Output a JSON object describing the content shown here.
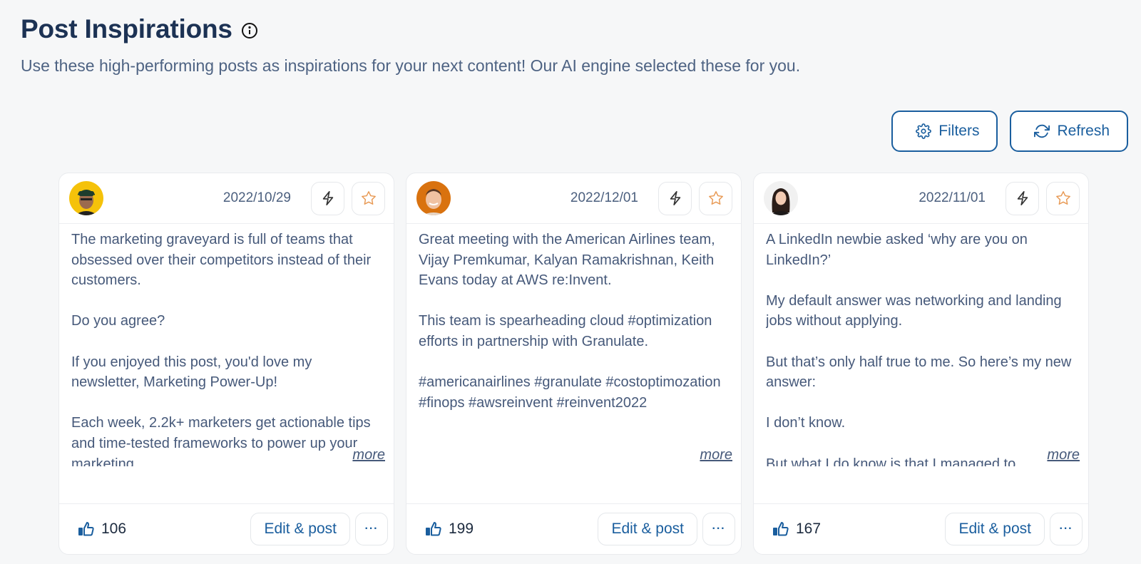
{
  "header": {
    "title": "Post Inspirations",
    "info_icon": "info-circle-icon",
    "subtitle": "Use these high-performing posts as inspirations for your next content! Our AI engine selected these for you."
  },
  "toolbar": {
    "filters_label": "Filters",
    "filters_icon": "gear-icon",
    "refresh_label": "Refresh",
    "refresh_icon": "refresh-icon"
  },
  "colors": {
    "accent": "#1a5e9e",
    "title": "#1c3254",
    "body_text": "#46597a",
    "star": "#e89a55",
    "background": "#f6f7f8"
  },
  "cards": [
    {
      "date": "2022/10/29",
      "avatar": "avatar-man-cap-yellow-bg",
      "text": "The marketing graveyard is full of teams that obsessed over their competitors instead of their customers.\n\nDo you agree?\n\nIf you enjoyed this post, you'd love my newsletter, Marketing Power-Up!\n\nEach week, 2.2k+ marketers get actionable tips and time-tested frameworks to power up your marketing.",
      "more_label": "more",
      "likes": "106",
      "edit_label": "Edit & post",
      "more_actions_label": "···"
    },
    {
      "date": "2022/12/01",
      "avatar": "avatar-man-orange-bg",
      "text": "Great meeting with the American Airlines team, Vijay Premkumar, Kalyan Ramakrishnan, Keith Evans today at AWS re:Invent.\n\nThis team is spearheading cloud #optimization efforts in partnership with Granulate.\n\n#americanairlines #granulate #costoptimozation #finops #awsreinvent #reinvent2022",
      "more_label": "more",
      "likes": "199",
      "edit_label": "Edit & post",
      "more_actions_label": "···"
    },
    {
      "date": "2022/11/01",
      "avatar": "avatar-woman-light-bg",
      "text": "A LinkedIn newbie asked ‘why are you on LinkedIn?’\n\nMy default answer was networking and landing jobs without applying.\n\nBut that’s only half true to me. So here’s my new answer:\n\nI don’t know.\n\nBut what I do know is that I managed to",
      "more_label": "more",
      "likes": "167",
      "edit_label": "Edit & post",
      "more_actions_label": "···"
    }
  ]
}
